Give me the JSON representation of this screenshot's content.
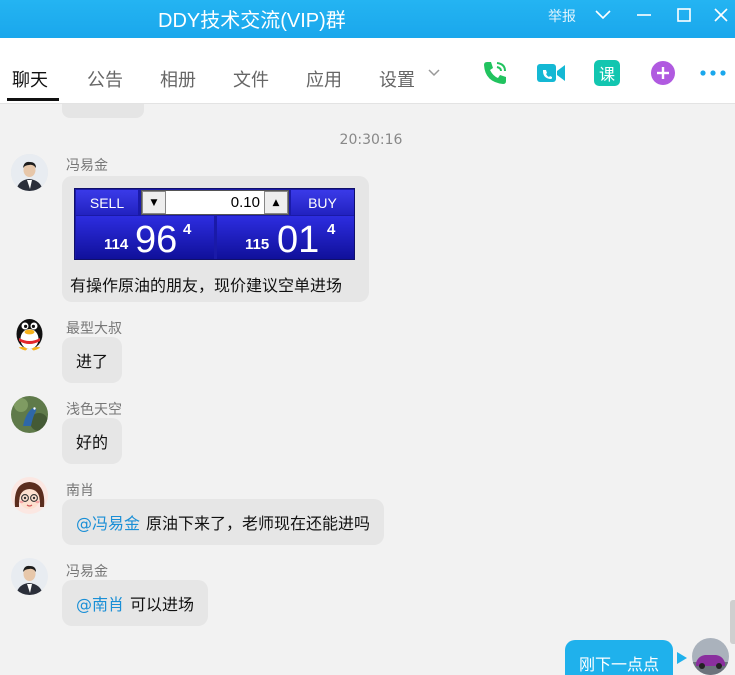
{
  "window": {
    "title": "DDY技术交流(VIP)群",
    "report_label": "举报"
  },
  "tabs": [
    {
      "label": "聊天",
      "active": true
    },
    {
      "label": "公告"
    },
    {
      "label": "相册"
    },
    {
      "label": "文件"
    },
    {
      "label": "应用"
    },
    {
      "label": "设置"
    }
  ],
  "actions": {
    "class_label": "课",
    "icons": [
      "phone-icon",
      "video-call-icon",
      "class-icon",
      "plus-app-icon",
      "more-icon"
    ]
  },
  "colors": {
    "titlebar": "#1aa7ec",
    "mention": "#1a8fd6",
    "my_bubble": "#1fb1ec",
    "phone_green": "#21c35f",
    "video_cyan": "#14b8d4",
    "class_teal": "#12c6b0",
    "plus_purple": "#b05ae0"
  },
  "chat": {
    "timestamp": "20:30:16",
    "messages": [
      {
        "sender": "冯易金",
        "type": "trade",
        "widget": {
          "sell_label": "SELL",
          "buy_label": "BUY",
          "quantity": "0.10",
          "sell_price_prefix": "114",
          "sell_price_main": "96",
          "sell_price_sup": "4",
          "buy_price_prefix": "115",
          "buy_price_main": "01",
          "buy_price_sup": "4"
        },
        "text": "有操作原油的朋友，现价建议空单进场"
      },
      {
        "sender": "最型大叔",
        "text": "进了"
      },
      {
        "sender": "浅色天空",
        "text": "好的"
      },
      {
        "sender": "南肖",
        "mention": "@冯易金",
        "text": "原油下来了，老师现在还能进吗"
      },
      {
        "sender": "冯易金",
        "mention": "@南肖",
        "text": "可以进场"
      },
      {
        "sender": "me",
        "text": "刚下一点点"
      }
    ]
  }
}
